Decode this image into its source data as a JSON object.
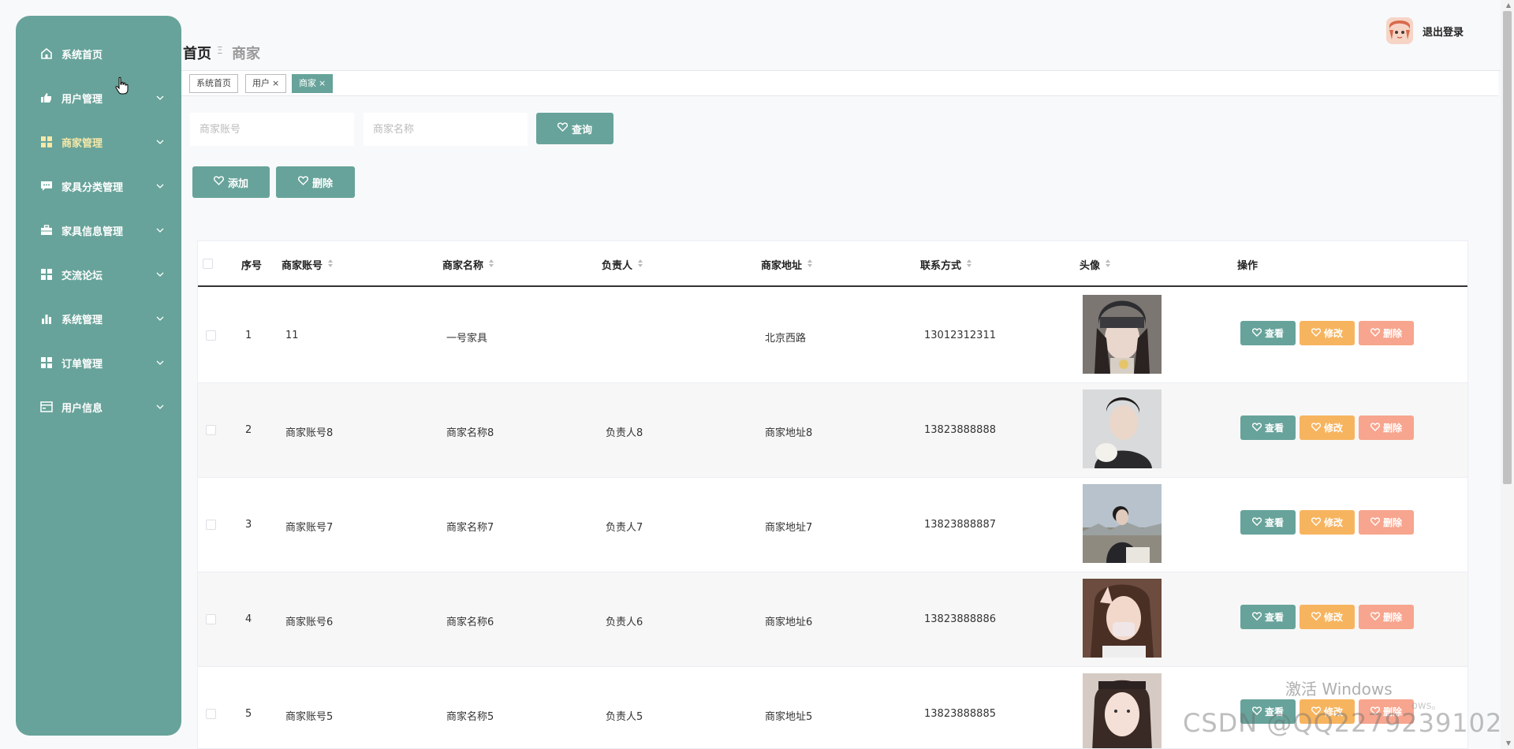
{
  "sidebar": {
    "items": [
      {
        "label": "系统首页",
        "icon": "home-icon"
      },
      {
        "label": "用户管理",
        "icon": "thumb-icon"
      },
      {
        "label": "商家管理",
        "icon": "grid-icon"
      },
      {
        "label": "家具分类管理",
        "icon": "chat-icon"
      },
      {
        "label": "家具信息管理",
        "icon": "briefcase-icon"
      },
      {
        "label": "交流论坛",
        "icon": "grid-icon"
      },
      {
        "label": "系统管理",
        "icon": "bar-chart-icon"
      },
      {
        "label": "订单管理",
        "icon": "grid-icon"
      },
      {
        "label": "用户信息",
        "icon": "card-icon"
      }
    ],
    "active_color": "#f6e8a8"
  },
  "header": {
    "breadcrumb_home": "首页",
    "breadcrumb_sep": "Ξ",
    "breadcrumb_current": "商家",
    "logout": "退出登录"
  },
  "tags": [
    {
      "label": "系统首页"
    },
    {
      "label": "用户",
      "close": "×"
    },
    {
      "label": "商家",
      "close": "×"
    }
  ],
  "search": {
    "account_placeholder": "商家账号",
    "name_placeholder": "商家名称",
    "query_label": "查询"
  },
  "actions": {
    "add_label": "添加",
    "delete_label": "删除"
  },
  "table": {
    "columns": [
      "序号",
      "商家账号",
      "商家名称",
      "负责人",
      "商家地址",
      "联系方式",
      "头像",
      "操作"
    ],
    "rows": [
      {
        "index": "1",
        "account": "11",
        "name": "一号家具",
        "owner": "",
        "address": "北京西路",
        "phone": "13012312311"
      },
      {
        "index": "2",
        "account": "商家账号8",
        "name": "商家名称8",
        "owner": "负责人8",
        "address": "商家地址8",
        "phone": "13823888888"
      },
      {
        "index": "3",
        "account": "商家账号7",
        "name": "商家名称7",
        "owner": "负责人7",
        "address": "商家地址7",
        "phone": "13823888887"
      },
      {
        "index": "4",
        "account": "商家账号6",
        "name": "商家名称6",
        "owner": "负责人6",
        "address": "商家地址6",
        "phone": "13823888886"
      },
      {
        "index": "5",
        "account": "商家账号5",
        "name": "商家名称5",
        "owner": "负责人5",
        "address": "商家地址5",
        "phone": "13823888885"
      }
    ],
    "op_view": "查看",
    "op_edit": "修改",
    "op_delete": "删除"
  },
  "watermark": {
    "line1": "激活 Windows",
    "line2": "ows。",
    "line3": "CSDN @QQ2279239102"
  },
  "colors": {
    "primary": "#67a39a",
    "edit": "#f7b45f",
    "delete": "#f7a58e"
  }
}
